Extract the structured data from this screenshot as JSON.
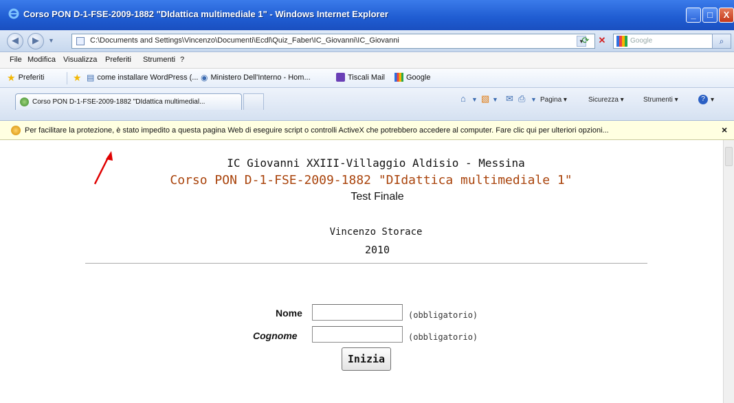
{
  "window": {
    "title": "Corso PON D-1-FSE-2009-1882 \"DIdattica multimediale 1\" - Windows Internet Explorer",
    "minimize_symbol": "_",
    "maximize_symbol": "□",
    "close_symbol": "X"
  },
  "address_bar": {
    "url": "C:\\Documents and Settings\\Vincenzo\\Documenti\\Ecdl\\Quiz_Faber\\IC_Giovanni\\IC_Giovanni",
    "search_placeholder": "Google"
  },
  "menu": [
    "File",
    "Modifica",
    "Visualizza",
    "Preferiti",
    "Strumenti",
    "?"
  ],
  "favorites": {
    "label": "Preferiti",
    "items": [
      "come installare WordPress (...",
      "Ministero Dell'Interno - Hom...",
      "Tiscali Mail",
      "Google"
    ]
  },
  "tab": {
    "label": "Corso PON D-1-FSE-2009-1882 \"DIdattica multimedial..."
  },
  "command_bar": [
    "Pagina",
    "Sicurezza",
    "Strumenti"
  ],
  "info_bar": {
    "message": "Per facilitare la protezione, è stato impedito a questa pagina Web di eseguire script o controlli ActiveX che potrebbero accedere al computer. Fare clic qui per ulteriori opzioni...",
    "close": "×"
  },
  "page": {
    "school": "IC Giovanni XXIII-Villaggio Aldisio - Messina",
    "course": "Corso PON D-1-FSE-2009-1882 \"DIdattica multimediale 1\"",
    "test": "Test Finale",
    "author": "Vincenzo Storace",
    "year": "2010"
  },
  "form": {
    "name_label": "Nome",
    "surname_label": "Cognome",
    "required_note": "(obbligatorio)",
    "name_value": "",
    "surname_value": "",
    "start_button": "Inizia"
  },
  "colors": {
    "title_bar": "#1f5cd1",
    "course_title": "#a9430b",
    "info_bar": "#ffffe1",
    "annotation_arrow": "#e00000"
  }
}
